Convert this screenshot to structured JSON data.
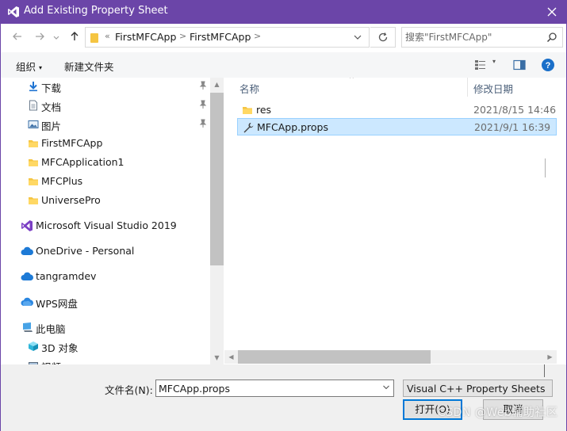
{
  "window": {
    "title": "Add Existing Property Sheet",
    "accent_color": "#6b45a8",
    "app_icon": "visual-studio-icon",
    "close_icon": "close-icon"
  },
  "address_bar": {
    "crumbs": [
      "FirstMFCApp",
      "FirstMFCApp"
    ],
    "overflow_chevron": "«",
    "separator": ">"
  },
  "search": {
    "placeholder": "搜索\"FirstMFCApp\""
  },
  "toolbar": {
    "organize_label": "组织",
    "new_folder_label": "新建文件夹"
  },
  "nav_pane": {
    "quick_access": [
      {
        "label": "下载",
        "icon": "download-icon",
        "pinned": true
      },
      {
        "label": "文档",
        "icon": "document-icon",
        "pinned": true
      },
      {
        "label": "图片",
        "icon": "pictures-icon",
        "pinned": true
      },
      {
        "label": "FirstMFCApp",
        "icon": "folder-icon",
        "pinned": false
      },
      {
        "label": "MFCApplication1",
        "icon": "folder-icon",
        "pinned": false
      },
      {
        "label": "MFCPlus",
        "icon": "folder-icon",
        "pinned": false
      },
      {
        "label": "UniversePro",
        "icon": "folder-icon",
        "pinned": false
      }
    ],
    "sections": [
      {
        "label": "Microsoft Visual Studio 2019",
        "icon": "visual-studio-icon"
      },
      {
        "label": "OneDrive - Personal",
        "icon": "cloud-icon"
      },
      {
        "label": "tangramdev",
        "icon": "cloud-icon"
      },
      {
        "label": "WPS网盘",
        "icon": "cloud-icon"
      },
      {
        "label": "此电脑",
        "icon": "computer-icon"
      }
    ],
    "this_pc": [
      {
        "label": "3D 对象",
        "icon": "cube-icon"
      },
      {
        "label": "视频",
        "icon": "video-icon"
      }
    ]
  },
  "file_list": {
    "columns": {
      "name": "名称",
      "modified": "修改日期"
    },
    "rows": [
      {
        "name": "res",
        "date": "2021/8/15 14:46",
        "icon": "folder-icon",
        "selected": false
      },
      {
        "name": "MFCApp.props",
        "date": "2021/9/1 16:39",
        "icon": "wrench-icon",
        "selected": true
      }
    ]
  },
  "bottom": {
    "filename_label": "文件名(N):",
    "filename_value": "MFCApp.props",
    "filter_value": "Visual C++ Property Sheets (*",
    "open_label": "打开(O)",
    "cancel_label": "取消"
  },
  "watermark": "CSDN @Web辅助社区"
}
